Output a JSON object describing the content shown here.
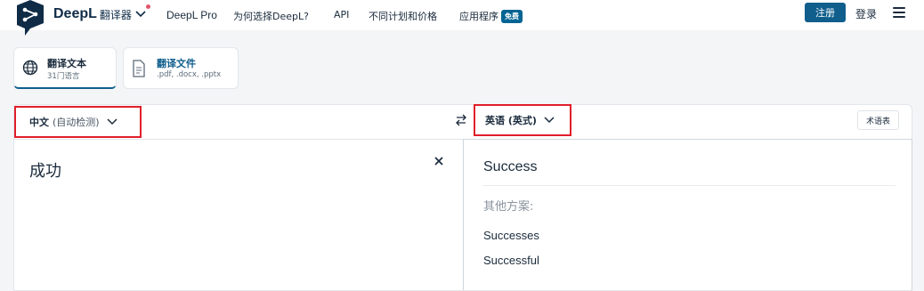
{
  "header": {
    "brand": "DeepL",
    "brand_sub": "翻译器",
    "nav": [
      "DeepL Pro",
      "为何选择DeepL?",
      "API",
      "不同计划和价格",
      "应用程序"
    ],
    "apps_badge": "免费",
    "signup": "注册",
    "login": "登录"
  },
  "modes": {
    "text": {
      "title": "翻译文本",
      "subtitle": "31门语言"
    },
    "file": {
      "title": "翻译文件",
      "subtitle": ".pdf, .docx, .pptx"
    }
  },
  "translator": {
    "source_lang": "中文",
    "source_lang_note": "(自动检测)",
    "target_lang": "英语 (英式)",
    "glossary": "术语表",
    "source_text": "成功",
    "target_text": "Success",
    "alternatives_label": "其他方案:",
    "alternatives": [
      "Successes",
      "Successful"
    ]
  },
  "colors": {
    "brand_blue": "#0f5e8c",
    "highlight_red": "#e01e2b",
    "notification_dot": "#e0576b"
  }
}
